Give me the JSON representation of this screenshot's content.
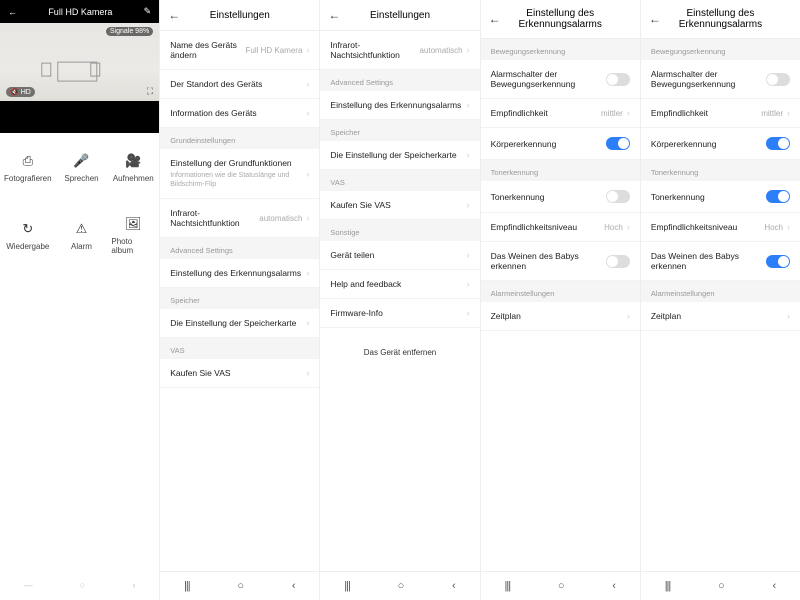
{
  "screen1": {
    "title": "Full HD Kamera",
    "signal_badge": "Signale 98%",
    "hd_badge": "HD",
    "buttons": {
      "foto": "Fotografieren",
      "sprechen": "Sprechen",
      "aufnehmen": "Aufnehmen",
      "wiedergabe": "Wiedergabe",
      "alarm": "Alarm",
      "album": "Photo album"
    }
  },
  "screen2": {
    "title": "Einstellungen",
    "rows": {
      "name_label": "Name des Geräts ändern",
      "name_value": "Full HD Kamera",
      "standort": "Der Standort des Geräts",
      "info": "Information des Geräts",
      "sec_grund": "Grundeinstellungen",
      "grund_label": "Einstellung der Grundfunktionen",
      "grund_sub": "Informationen wie die Statuslänge und Bildschirm-Flip",
      "infrarot_label": "Infrarot-Nachtsichtfunktion",
      "infrarot_value": "automatisch",
      "sec_adv": "Advanced Settings",
      "erkennung": "Einstellung des Erkennungsalarms",
      "sec_speicher": "Speicher",
      "speicherkarte": "Die Einstellung der Speicherkarte",
      "sec_vas": "VAS",
      "vas": "Kaufen Sie VAS"
    }
  },
  "screen3": {
    "title": "Einstellungen",
    "rows": {
      "infrarot_label": "Infrarot-Nachtsichtfunktion",
      "infrarot_value": "automatisch",
      "sec_adv": "Advanced Settings",
      "erkennung": "Einstellung des Erkennungsalarms",
      "sec_speicher": "Speicher",
      "speicherkarte": "Die Einstellung der Speicherkarte",
      "sec_vas": "VAS",
      "vas": "Kaufen Sie VAS",
      "sec_sonstige": "Sonstige",
      "teilen": "Gerät teilen",
      "help": "Help and feedback",
      "firmware": "Firmware-Info",
      "remove": "Das Gerät entfernen"
    }
  },
  "alarm_title": "Einstellung des Erkennungsalarms",
  "alarm_sections": {
    "bewegung": "Bewegungserkennung",
    "ton": "Tonerkennung",
    "einst": "Alarmeinstellungen"
  },
  "alarm_rows": {
    "alarmschalter": "Alarmschalter der Bewegungserkennung",
    "empfindlichkeit": "Empfindlichkeit",
    "empf_value": "mittler",
    "koerper": "Körpererkennung",
    "tonerkennung": "Tonerkennung",
    "empf_niveau": "Empfindlichkeitsniveau",
    "niveau_value": "Hoch",
    "baby": "Das Weinen des Babys erkennen",
    "zeitplan": "Zeitplan"
  },
  "nav": {
    "bars": "|||",
    "circle": "○",
    "back": "‹"
  }
}
